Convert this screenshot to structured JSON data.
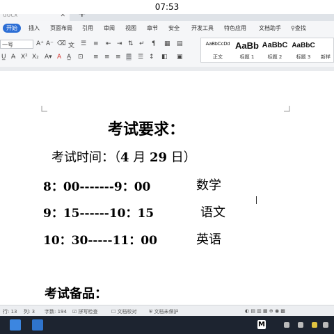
{
  "overlay": {
    "time": "07:53"
  },
  "tabs": {
    "doc_tab": "docx",
    "close": "✕",
    "new": "+"
  },
  "menu": [
    "开始",
    "插入",
    "页面布局",
    "引用",
    "审阅",
    "视图",
    "章节",
    "安全",
    "开发工具",
    "特色应用",
    "文档助手",
    "查找"
  ],
  "toolbar": {
    "font_size": "一号"
  },
  "styles": [
    {
      "sample": "AaBbCcDd",
      "name": "正文"
    },
    {
      "sample": "AaBb",
      "name": "标题 1"
    },
    {
      "sample": "AaBbC",
      "name": "标题 2"
    },
    {
      "sample": "AaBbC",
      "name": "标题 3"
    },
    {
      "sample": "",
      "name": "新样"
    }
  ],
  "document": {
    "title": "考试要求：",
    "time_label": "考试时间：（",
    "time_month": "4",
    "time_month_unit": " 月 ",
    "time_day": "29",
    "time_day_unit": " 日）",
    "schedule": [
      {
        "time": "8：00-------9：00",
        "subject": "数学"
      },
      {
        "time": "9：15------10：15",
        "subject": "语文"
      },
      {
        "time": "10：30-----11：00",
        "subject": "英语"
      }
    ],
    "supplies": "考试备品："
  },
  "status": {
    "row": "行: 13",
    "col": "列: 3",
    "words": "字数: 194",
    "spell": "拼写检查",
    "proof": "文档校对",
    "protect": "文档未保护"
  },
  "colors": {
    "accent": "#2c6ed5",
    "taskbar": "#1d2430"
  }
}
